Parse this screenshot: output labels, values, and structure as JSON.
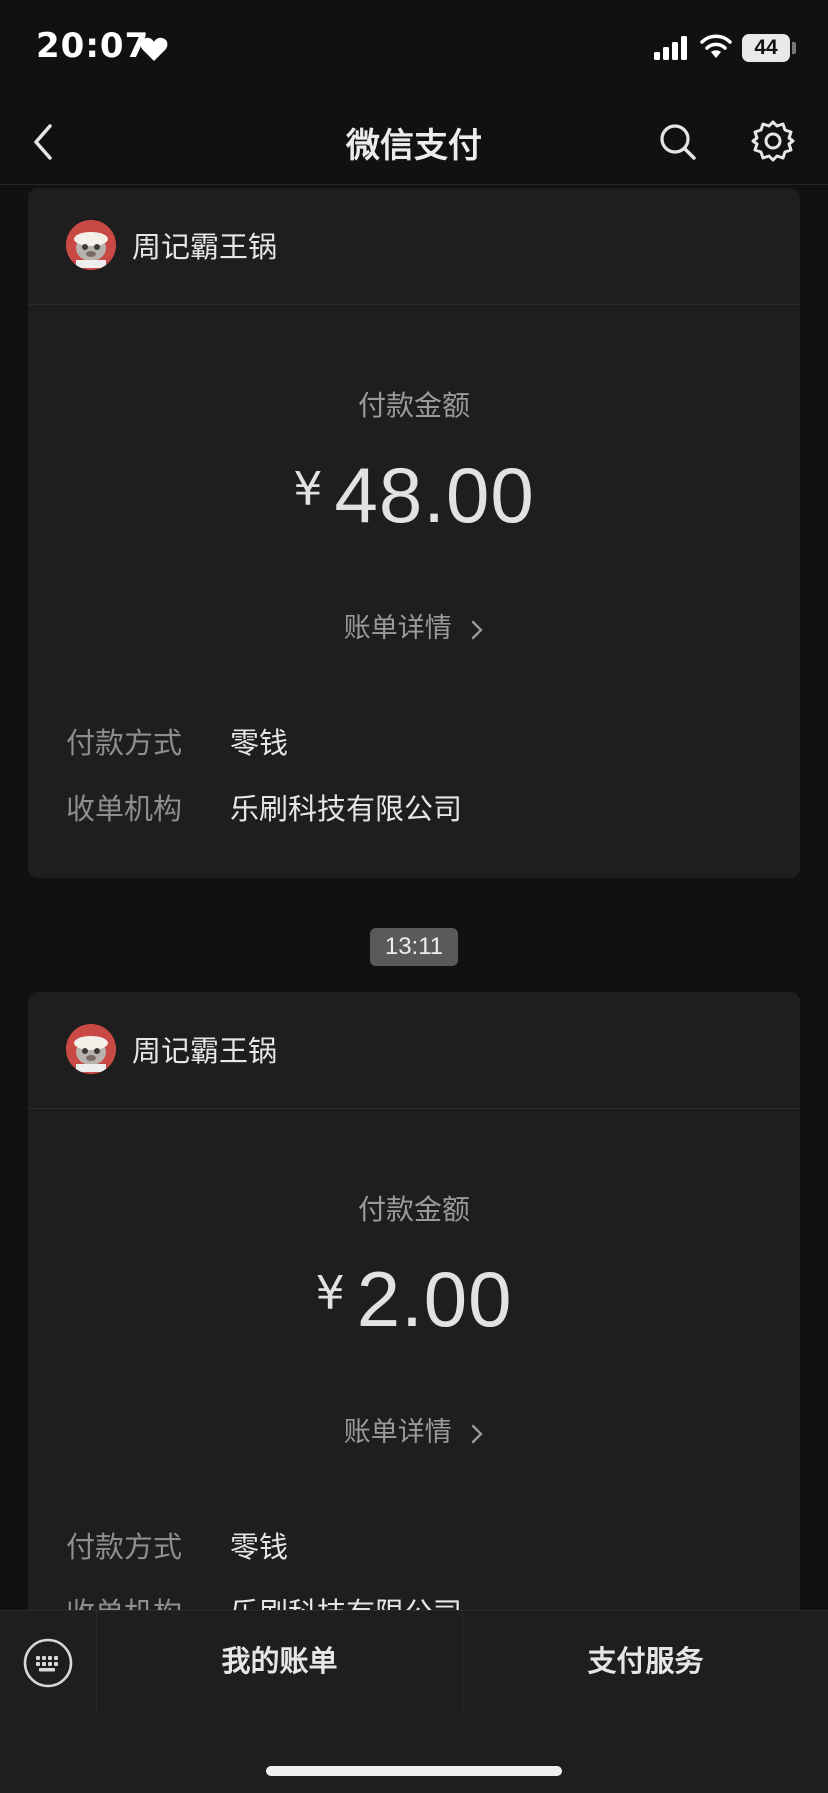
{
  "status_bar": {
    "time": "20:07",
    "battery": "44"
  },
  "nav": {
    "title": "微信支付"
  },
  "cards": [
    {
      "merchant": "周记霸王锅",
      "amount_label": "付款金额",
      "currency": "¥",
      "amount": "48.00",
      "bill_link": "账单详情",
      "rows": [
        {
          "label": "付款方式",
          "value": "零钱"
        },
        {
          "label": "收单机构",
          "value": "乐刷科技有限公司"
        }
      ]
    },
    {
      "merchant": "周记霸王锅",
      "amount_label": "付款金额",
      "currency": "¥",
      "amount": "2.00",
      "bill_link": "账单详情",
      "rows": [
        {
          "label": "付款方式",
          "value": "零钱"
        },
        {
          "label": "收单机构",
          "value": "乐刷科技有限公司"
        }
      ]
    }
  ],
  "timestamp": "13:11",
  "bottom_bar": {
    "my_bill": "我的账单",
    "pay_service": "支付服务"
  },
  "icons": [
    "heart-icon",
    "signal-icon",
    "wifi-icon",
    "back-icon",
    "search-icon",
    "settings-icon",
    "chevron-right-icon",
    "keyboard-icon"
  ]
}
